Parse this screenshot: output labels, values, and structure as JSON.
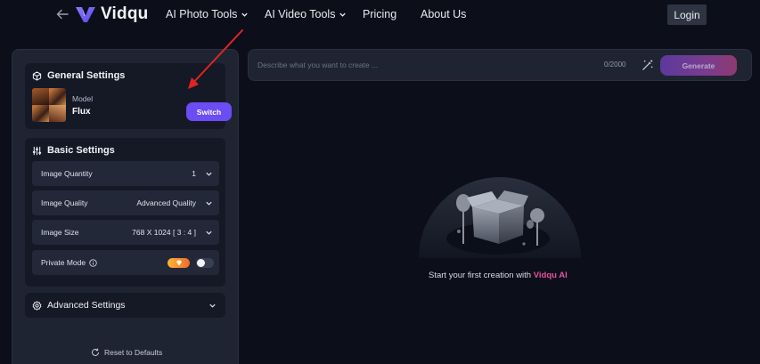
{
  "nav": {
    "logo_text": "Vidqu",
    "items": [
      {
        "label": "AI Photo Tools",
        "has_dropdown": true
      },
      {
        "label": "AI Video Tools",
        "has_dropdown": true
      },
      {
        "label": "Pricing",
        "has_dropdown": false
      },
      {
        "label": "About Us",
        "has_dropdown": false
      }
    ],
    "login_label": "Login"
  },
  "general_settings": {
    "title": "General Settings",
    "model_label": "Model",
    "model_name": "Flux",
    "switch_label": "Switch"
  },
  "basic_settings": {
    "title": "Basic Settings",
    "rows": [
      {
        "label": "Image Quantity",
        "value": "1"
      },
      {
        "label": "Image Quality",
        "value": "Advanced Quality"
      },
      {
        "label": "Image Size",
        "value": "768 X 1024 [ 3 : 4 ]"
      }
    ],
    "private_mode": {
      "label": "Private Mode",
      "enabled": false
    }
  },
  "advanced_settings": {
    "title": "Advanced Settings"
  },
  "reset_label": "Reset to Defaults",
  "prompt": {
    "placeholder": "Describe what you want to create ...",
    "value": "",
    "char_count": "0/2000",
    "generate_label": "Generate"
  },
  "empty_state": {
    "text_prefix": "Start your first creation with ",
    "brand": "Vidqu AI"
  },
  "colors": {
    "background": "#0c0f19",
    "panel": "#1f2433",
    "accent": "#6b4cf5",
    "brand_pink": "#e84fa0",
    "annotation_arrow": "#e02424"
  }
}
